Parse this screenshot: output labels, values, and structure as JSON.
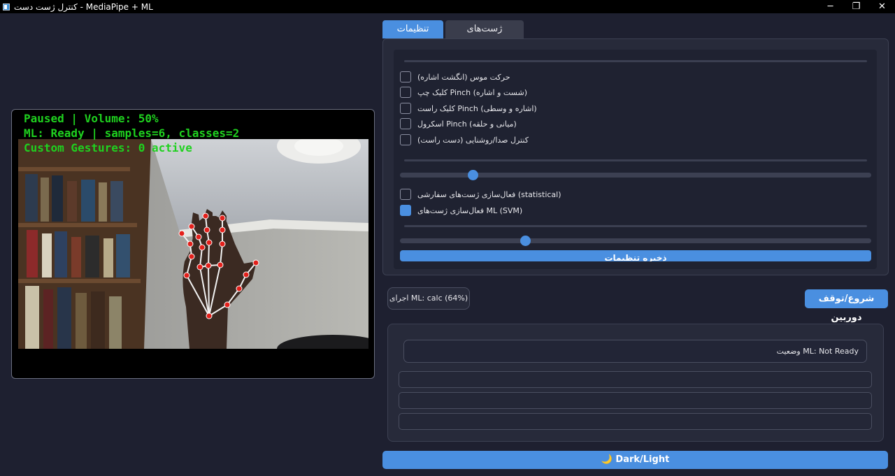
{
  "window": {
    "title": "کنترل ژست دست - MediaPipe + ML",
    "minimize": "─",
    "restore": "❐",
    "close": "✕"
  },
  "camera": {
    "overlay": [
      "Paused | Volume: 50%",
      "ML: Ready | samples=6, classes=2",
      "Custom Gestures: 0 active"
    ],
    "hand_landmark_color": "#e3201b",
    "overlay_color": "#1fd11f"
  },
  "tabs": [
    {
      "label": "تنظیمات پایه",
      "active": true
    },
    {
      "label": "ژست‌های سفارشی",
      "active": false
    }
  ],
  "settings": {
    "checkboxes": [
      {
        "label": "حرکت موس (انگشت اشاره)",
        "checked": false
      },
      {
        "label": "کلیک چپ Pinch (شست و اشاره)",
        "checked": false
      },
      {
        "label": "کلیک راست Pinch (اشاره و وسطی)",
        "checked": false
      },
      {
        "label": "اسکرول Pinch (میانی و حلقه)",
        "checked": false
      },
      {
        "label": "کنترل صدا/روشنایی (دست راست)",
        "checked": false
      }
    ],
    "slider1_value": 0.154,
    "checkboxes2": [
      {
        "label": "فعال‌سازی ژست‌های سفارشی (statistical)",
        "checked": false
      },
      {
        "label": "فعال‌سازی ژست‌های ML (SVM)",
        "checked": true
      }
    ],
    "slider2_value": 0.266,
    "save_label": "ذخیره تنظیمات"
  },
  "ml_status": "اجرای ML: calc (64%)",
  "camera_button": "شروع/توقف دوربین",
  "status": {
    "label": "وضعیت ML: Not Ready"
  },
  "theme_button": "🌙 Dark/Light",
  "accent_color": "#4a8fe0"
}
